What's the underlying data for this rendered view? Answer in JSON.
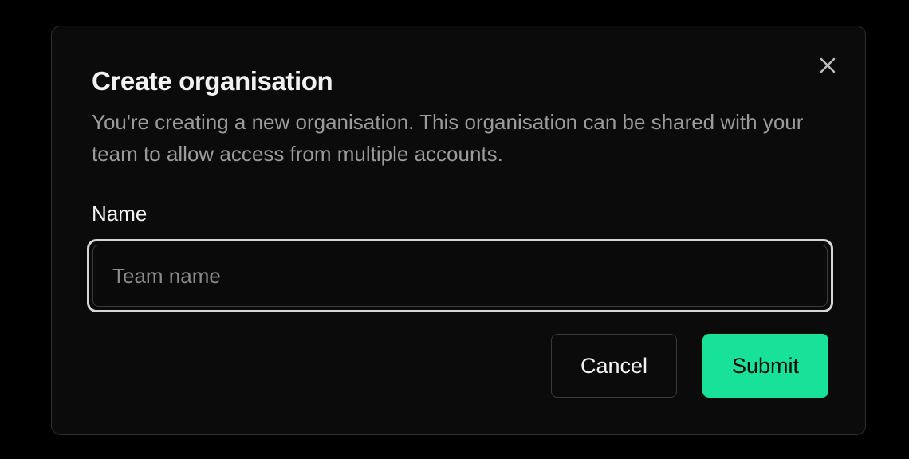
{
  "dialog": {
    "title": "Create organisation",
    "description": "You're creating a new organisation. This organisation can be shared with your team to allow access from multiple accounts.",
    "close_icon": "close-icon"
  },
  "form": {
    "name_label": "Name",
    "name_value": "",
    "name_placeholder": "Team name"
  },
  "actions": {
    "cancel_label": "Cancel",
    "submit_label": "Submit"
  },
  "colors": {
    "background": "#000000",
    "dialog_background": "#0b0b0b",
    "accent": "#18e299",
    "text_primary": "#f2f2f2",
    "text_muted": "#9b9b9b"
  }
}
